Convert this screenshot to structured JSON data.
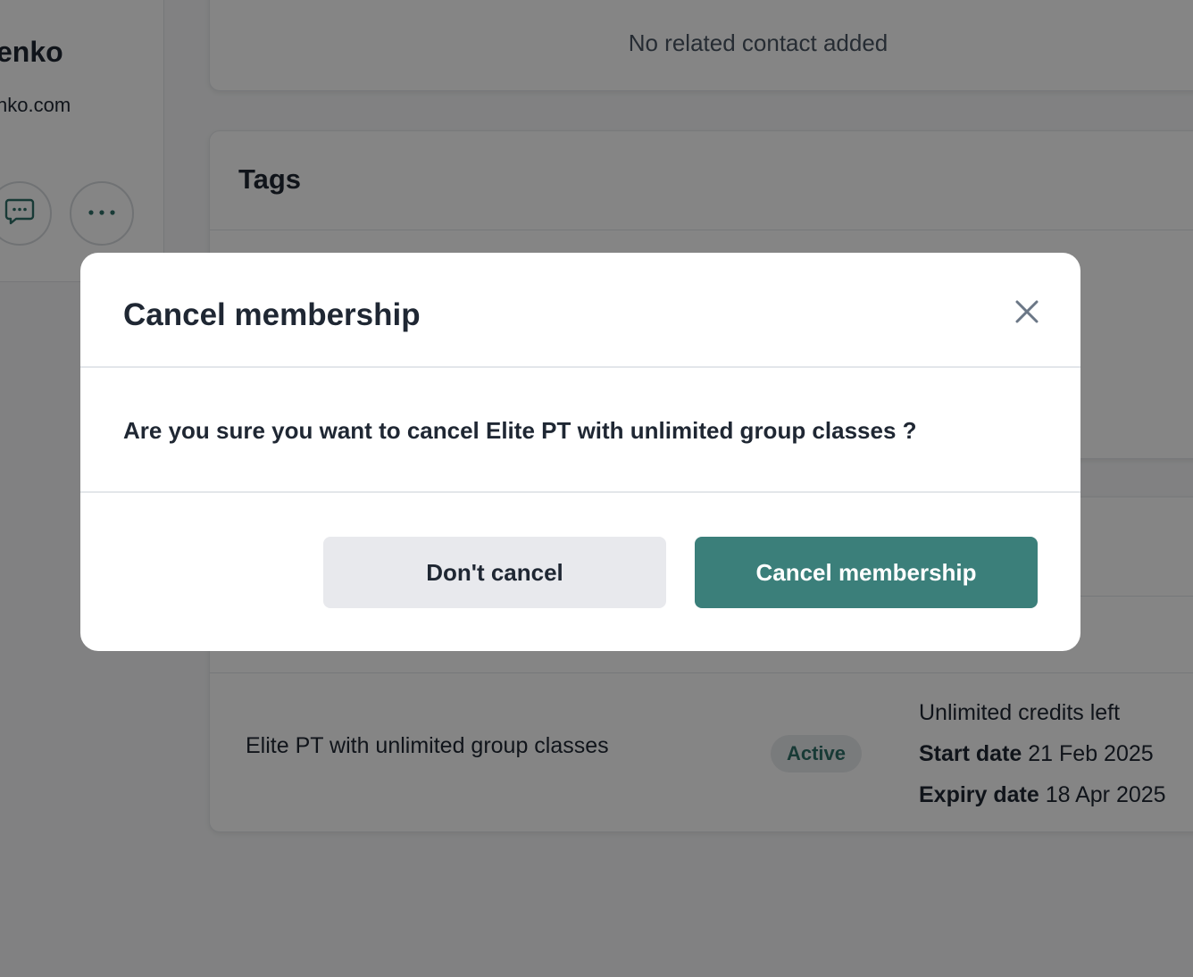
{
  "contact": {
    "name": "enko",
    "email": "nko.com"
  },
  "contact_actions": [
    {
      "icon": "message-icon"
    },
    {
      "icon": "more-icon"
    }
  ],
  "related_contacts": {
    "empty_text": "No related contact added"
  },
  "tags": {
    "title": "Tags"
  },
  "membership": {
    "name": "Elite PT with unlimited group classes",
    "status": "Active",
    "credits": "Unlimited credits left",
    "start_label": "Start date",
    "start_value": "21 Feb 2025",
    "expiry_label": "Expiry date",
    "expiry_value": "18 Apr 2025"
  },
  "modal": {
    "title": "Cancel membership",
    "message": "Are you sure you want to cancel Elite PT with unlimited group classes ?",
    "secondary_label": "Don't cancel",
    "primary_label": "Cancel membership",
    "close_icon": "close-icon"
  },
  "colors": {
    "primary": "#3b7f7a",
    "secondary_bg": "#e8e9ed",
    "text": "#1f2733",
    "overlay": "rgba(0,0,0,0.48)"
  }
}
